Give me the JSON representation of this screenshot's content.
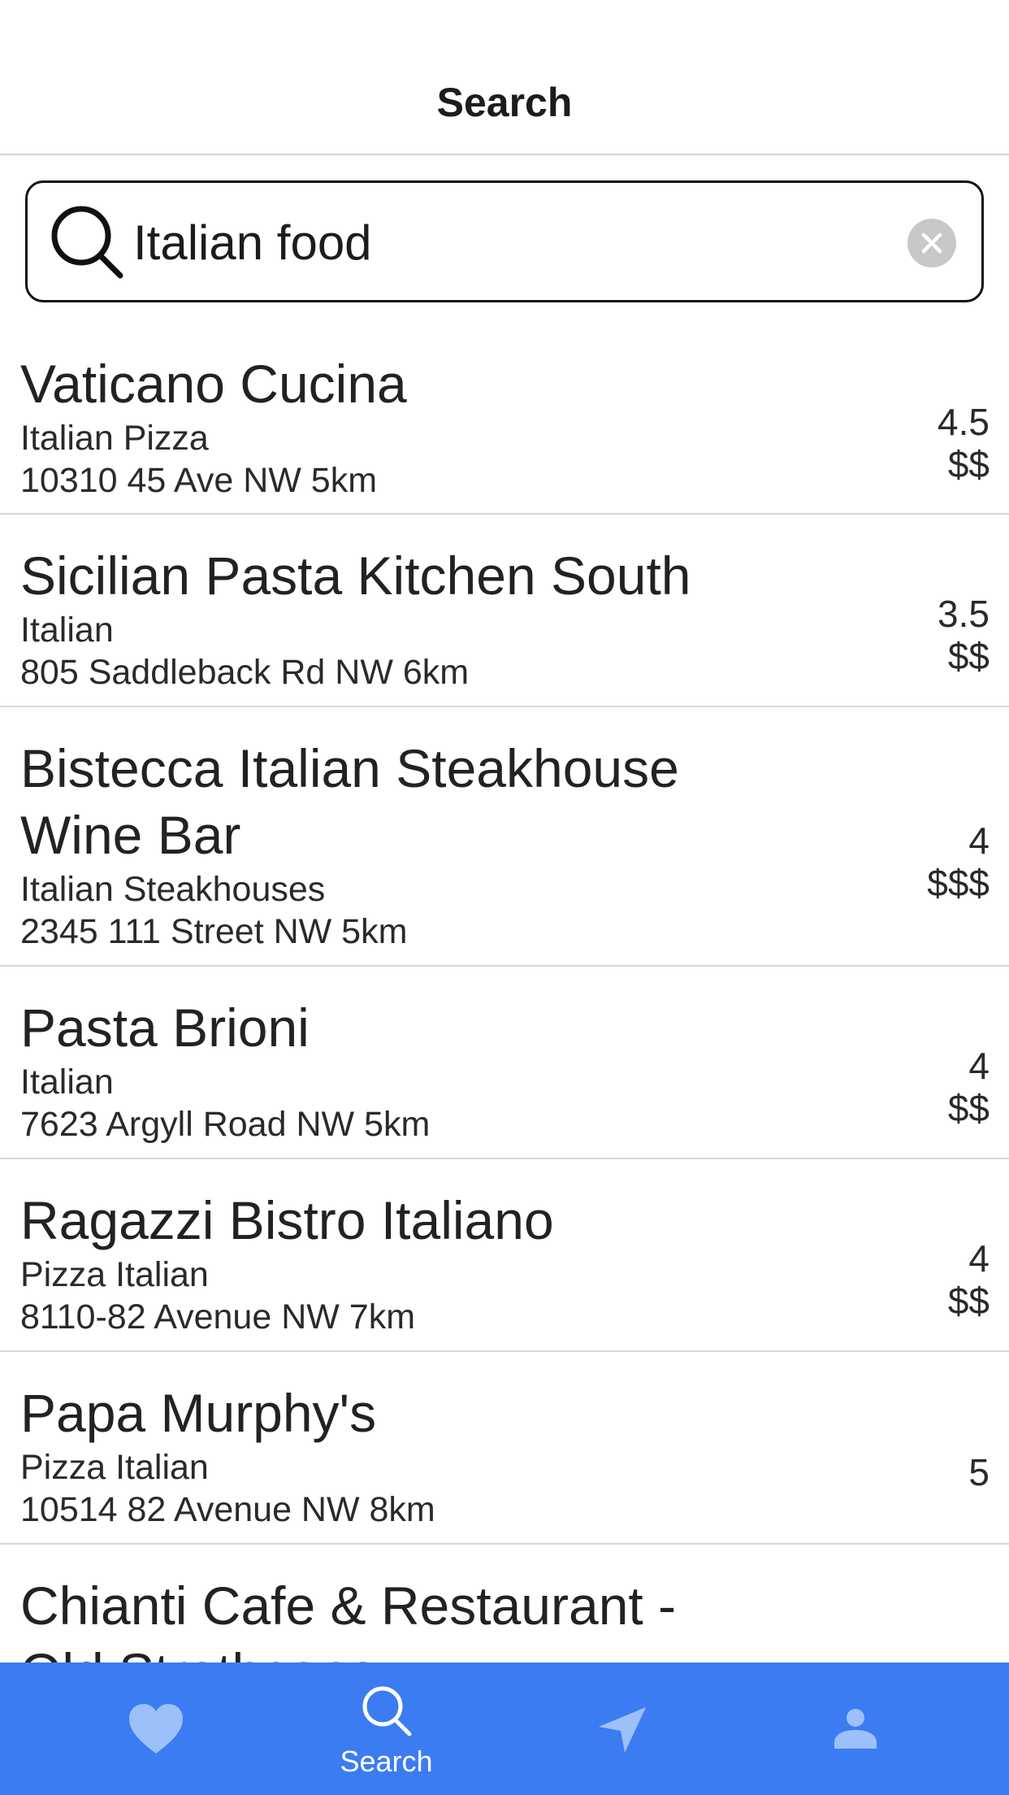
{
  "header": {
    "title": "Search"
  },
  "search": {
    "value": "Italian food",
    "placeholder": ""
  },
  "results": [
    {
      "name": "Vaticano Cucina",
      "category": "Italian Pizza",
      "address": "10310 45 Ave NW 5km",
      "rating": "4.5",
      "price": "$$"
    },
    {
      "name": "Sicilian Pasta Kitchen South",
      "category": "Italian",
      "address": "805 Saddleback Rd NW 6km",
      "rating": "3.5",
      "price": "$$"
    },
    {
      "name": "Bistecca Italian Steakhouse Wine Bar",
      "category": "Italian Steakhouses",
      "address": "2345 111 Street NW 5km",
      "rating": "4",
      "price": "$$$"
    },
    {
      "name": "Pasta Brioni",
      "category": "Italian",
      "address": "7623 Argyll Road NW 5km",
      "rating": "4",
      "price": "$$"
    },
    {
      "name": "Ragazzi Bistro Italiano",
      "category": "Pizza Italian",
      "address": "8110-82 Avenue NW 7km",
      "rating": "4",
      "price": "$$"
    },
    {
      "name": "Papa Murphy's",
      "category": "Pizza Italian",
      "address": "10514 82 Avenue NW 8km",
      "rating": "5",
      "price": ""
    },
    {
      "name": "Chianti Cafe & Restaurant - Old Strathcona",
      "category": "",
      "address": "",
      "rating": "",
      "price": ""
    }
  ],
  "tabbar": {
    "color": "#3b7cf2",
    "tabs": [
      {
        "icon": "heart-icon",
        "label": "",
        "active": false
      },
      {
        "icon": "search-icon",
        "label": "Search",
        "active": true
      },
      {
        "icon": "location-arrow-icon",
        "label": "",
        "active": false
      },
      {
        "icon": "person-icon",
        "label": "",
        "active": false
      }
    ]
  }
}
